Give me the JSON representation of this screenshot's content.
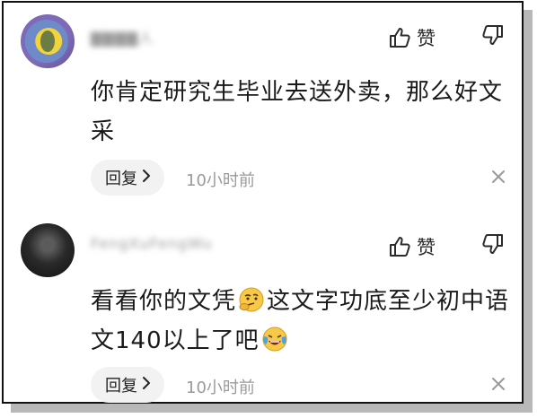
{
  "comments": [
    {
      "username": "▇▇▇▇人",
      "text": "你肯定研究生毕业去送外卖，那么好文采",
      "like_label": "赞",
      "reply_label": "回复",
      "time": "10小时前"
    },
    {
      "username": "FengXuFengWu",
      "text_before_emoji": "看看你的文凭",
      "text_after_emoji": "这文字功底至少初中语文140以上了吧",
      "emoji_1": "thinking-emoji",
      "emoji_2": "crying-laughing-emoji",
      "like_label": "赞",
      "reply_label": "回复",
      "time": "10小时前"
    }
  ],
  "colors": {
    "text": "#1a1a1a",
    "muted": "#9a9a9a",
    "reply_bg": "#f2f2f2"
  }
}
